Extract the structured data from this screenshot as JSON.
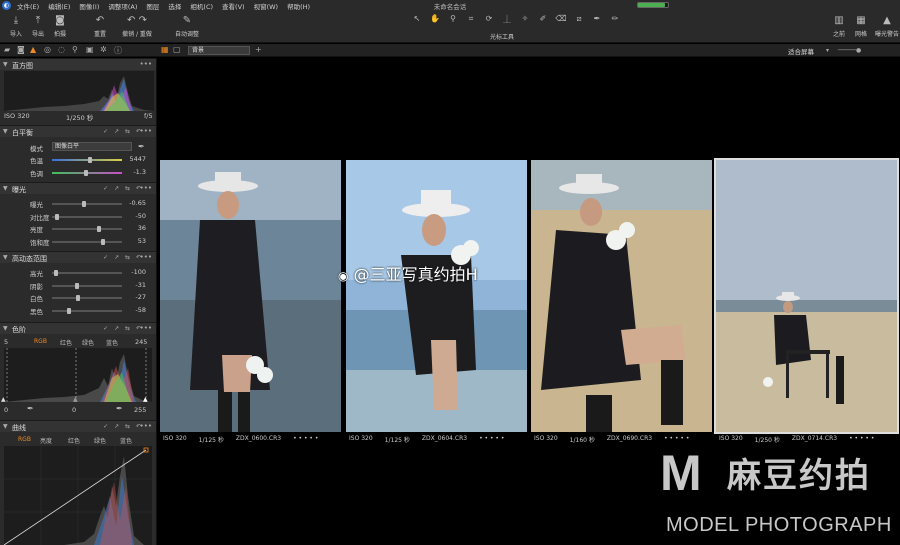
{
  "window": {
    "title": "未命名会话",
    "menu": [
      "文件(E)",
      "编辑(E)",
      "图像(I)",
      "调整项(A)",
      "图层",
      "选择",
      "相机(C)",
      "查看(V)",
      "视窗(W)",
      "帮助(H)"
    ],
    "progress_fraction": 0.9
  },
  "toolbar": {
    "import": "导入",
    "export": "导出",
    "capture": "拍摄",
    "reset": "重置",
    "undo_redo": "撤销 / 重做",
    "auto_adjust": "自动调整",
    "cursor_tools_label": "光标工具",
    "before": "之前",
    "grid": "网格",
    "exposure_warning": "曝光警告"
  },
  "tabbar": {
    "view_select": "背景",
    "fit_screen": "适合屏幕"
  },
  "histogram": {
    "title": "直方图",
    "iso": "ISO 320",
    "shutter": "1/250 秒",
    "aperture": "f/5"
  },
  "white_balance": {
    "title": "白平衡",
    "mode_label": "模式",
    "mode_value": "图像白平",
    "temp_label": "色温",
    "temp_value": "5447",
    "tint_label": "色调",
    "tint_value": "-1.3"
  },
  "exposure": {
    "title": "曝光",
    "rows": [
      {
        "label": "曝光",
        "value": "-0.65",
        "pos": 0.45
      },
      {
        "label": "对比度",
        "value": "-50",
        "pos": 0.05
      },
      {
        "label": "亮度",
        "value": "36",
        "pos": 0.68
      },
      {
        "label": "饱和度",
        "value": "53",
        "pos": 0.74
      }
    ]
  },
  "hdr": {
    "title": "高动态范围",
    "rows": [
      {
        "label": "高光",
        "value": "-100",
        "pos": 0.03
      },
      {
        "label": "阴影",
        "value": "-31",
        "pos": 0.35
      },
      {
        "label": "白色",
        "value": "-27",
        "pos": 0.37
      },
      {
        "label": "黑色",
        "value": "-58",
        "pos": 0.22
      }
    ]
  },
  "levels": {
    "title": "色阶",
    "low": "5",
    "high": "245",
    "channels": [
      "RGB",
      "红色",
      "绿色",
      "蓝色"
    ],
    "out_low": "0",
    "out_mid": "0",
    "out_high": "255"
  },
  "curve": {
    "title": "曲线",
    "channels": [
      "RGB",
      "亮度",
      "红色",
      "绿色",
      "蓝色"
    ]
  },
  "thumbnails": [
    {
      "iso": "ISO 320",
      "shutter": "1/125 秒",
      "file": "ZDX_0600.CR3",
      "rating": "• • • • •"
    },
    {
      "iso": "ISO 320",
      "shutter": "1/125 秒",
      "file": "ZDX_0604.CR3",
      "rating": "• • • • •"
    },
    {
      "iso": "ISO 320",
      "shutter": "1/160 秒",
      "file": "ZDX_0690.CR3",
      "rating": "• • • • •"
    },
    {
      "iso": "ISO 320",
      "shutter": "1/250 秒",
      "file": "ZDX_0714.CR3",
      "rating": "• • • • •"
    }
  ],
  "watermarks": {
    "weibo": "@三亚写真约拍H",
    "logo_letter": "M",
    "logo_cn": "麻豆约拍",
    "logo_en": "MODEL PHOTOGRAPH"
  }
}
